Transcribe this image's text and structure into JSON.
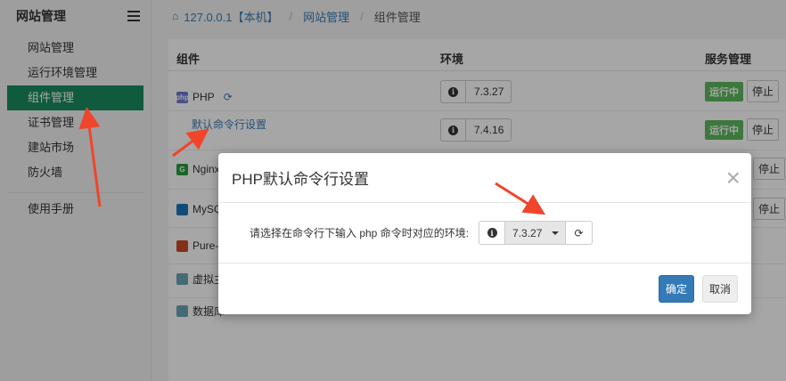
{
  "sidebar": {
    "title": "网站管理",
    "items": [
      {
        "label": "网站管理"
      },
      {
        "label": "运行环境管理"
      },
      {
        "label": "组件管理"
      },
      {
        "label": "证书管理"
      },
      {
        "label": "建站市场"
      },
      {
        "label": "防火墙"
      }
    ],
    "footer_item": "使用手册"
  },
  "breadcrumb": {
    "host": "127.0.0.1【本机】",
    "section": "网站管理",
    "current": "组件管理"
  },
  "table": {
    "headers": {
      "component": "组件",
      "env": "环境",
      "service": "服务管理"
    },
    "rows": [
      {
        "name": "PHP",
        "icon_text": "php",
        "icon_color": "#6f7ad1"
      },
      {
        "name": "Nginx",
        "icon_text": "G",
        "icon_color": "#2a9b3c"
      },
      {
        "name": "MySQL",
        "icon_text": "",
        "icon_color": "#1b76b8"
      },
      {
        "name": "Pure-FTPd",
        "icon_text": "",
        "icon_color": "#c94a2a"
      },
      {
        "name": "虚拟主机",
        "icon_text": "",
        "icon_color": "#6aa3b0"
      },
      {
        "name": "数据库",
        "icon_text": "",
        "icon_color": "#6aa3b0"
      }
    ],
    "php_cli_link": "默认命令行设置",
    "versions": [
      "7.3.27",
      "7.4.16"
    ],
    "status_running": "运行中",
    "stop_label": "停止"
  },
  "modal": {
    "title": "PHP默认命令行设置",
    "label": "请选择在命令行下输入 php 命令时对应的环境:",
    "selected_version": "7.3.27",
    "ok_label": "确定",
    "cancel_label": "取消"
  },
  "colors": {
    "active_green": "#1a8d5f",
    "link_blue": "#3a7bb6",
    "badge_green": "#5cb85c",
    "primary": "#337ab7",
    "arrow_red": "#f0452b"
  }
}
